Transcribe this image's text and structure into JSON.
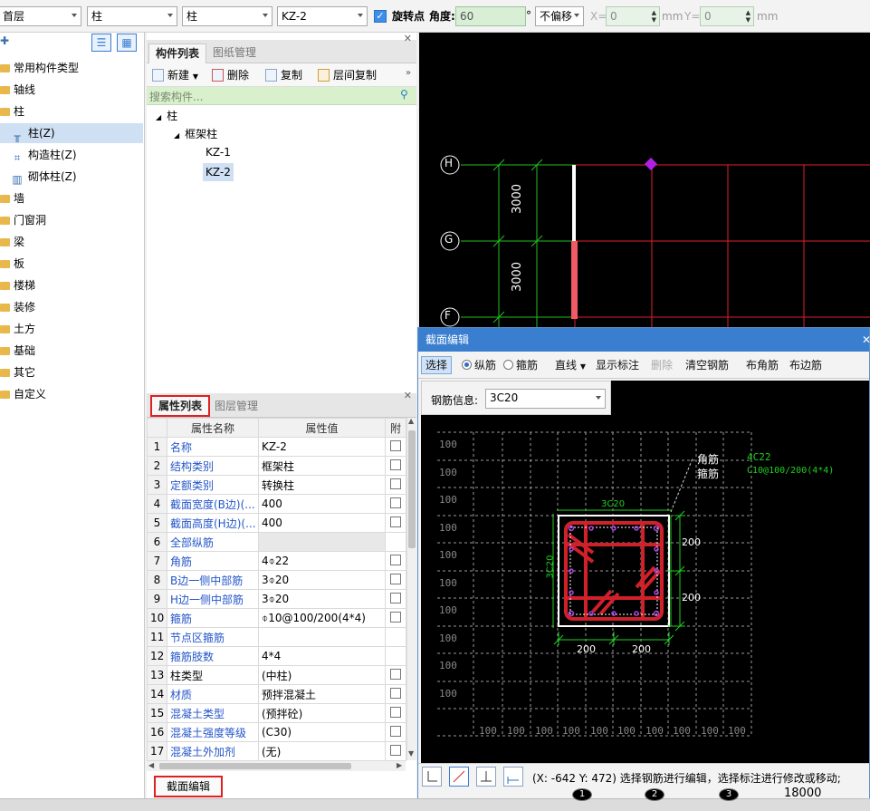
{
  "toolbar": {
    "floor": "首层",
    "category": "柱",
    "subcategory": "柱",
    "component": "KZ-2",
    "rotate_label": "旋转点",
    "angle_label": "角度:",
    "angle_value": "60",
    "degree": "°",
    "offset_mode": "不偏移",
    "x_label": "X=",
    "x_value": "0",
    "mm1": "mm",
    "y_label": "Y=",
    "y_value": "0",
    "mm2": "mm"
  },
  "left_tree": {
    "items": [
      {
        "label": "常用构件类型"
      },
      {
        "label": "轴线"
      },
      {
        "label": "柱"
      },
      {
        "label": "柱(Z)"
      },
      {
        "label": "构造柱(Z)"
      },
      {
        "label": "砌体柱(Z)"
      },
      {
        "label": "墙"
      },
      {
        "label": "门窗洞"
      },
      {
        "label": "梁"
      },
      {
        "label": "板"
      },
      {
        "label": "楼梯"
      },
      {
        "label": "装修"
      },
      {
        "label": "土方"
      },
      {
        "label": "基础"
      },
      {
        "label": "其它"
      },
      {
        "label": "自定义"
      }
    ]
  },
  "component_list": {
    "tab_active": "构件列表",
    "tab_other": "图纸管理",
    "new_btn": "新建",
    "delete_btn": "删除",
    "copy_btn": "复制",
    "floor_copy_btn": "层间复制",
    "search_placeholder": "搜索构件...",
    "tree": {
      "root": "柱",
      "group": "框架柱",
      "items": [
        "KZ-1",
        "KZ-2"
      ]
    }
  },
  "properties": {
    "tab_active": "属性列表",
    "tab_other": "图层管理",
    "col_name": "属性名称",
    "col_value": "属性值",
    "col_extra": "附",
    "rows": [
      {
        "n": "1",
        "name": "名称",
        "value": "KZ-2"
      },
      {
        "n": "2",
        "name": "结构类别",
        "value": "框架柱"
      },
      {
        "n": "3",
        "name": "定额类别",
        "value": "转换柱"
      },
      {
        "n": "4",
        "name": "截面宽度(B边)(...",
        "value": "400"
      },
      {
        "n": "5",
        "name": "截面高度(H边)(...",
        "value": "400"
      },
      {
        "n": "6",
        "name": "全部纵筋",
        "value": ""
      },
      {
        "n": "7",
        "name": "角筋",
        "value": "4⌽22"
      },
      {
        "n": "8",
        "name": "B边一侧中部筋",
        "value": "3⌽20"
      },
      {
        "n": "9",
        "name": "H边一侧中部筋",
        "value": "3⌽20"
      },
      {
        "n": "10",
        "name": "箍筋",
        "value": "⌽10@100/200(4*4)"
      },
      {
        "n": "11",
        "name": "节点区箍筋",
        "value": ""
      },
      {
        "n": "12",
        "name": "箍筋肢数",
        "value": "4*4"
      },
      {
        "n": "13",
        "name": "柱类型",
        "value": "(中柱)"
      },
      {
        "n": "14",
        "name": "材质",
        "value": "预拌混凝土"
      },
      {
        "n": "15",
        "name": "混凝土类型",
        "value": "(预拌砼)"
      },
      {
        "n": "16",
        "name": "混凝土强度等级",
        "value": "(C30)"
      },
      {
        "n": "17",
        "name": "混凝土外加剂",
        "value": "(无)"
      }
    ],
    "bottom_tab": "截面编辑"
  },
  "canvas": {
    "axes": [
      "H",
      "G",
      "F"
    ],
    "dims": [
      "3000",
      "3000"
    ],
    "bottom_number": "18000",
    "bottom_axes": [
      "1",
      "2",
      "3"
    ]
  },
  "section_editor": {
    "title": "截面编辑",
    "tools": {
      "select": "选择",
      "longitudinal": "纵筋",
      "stirrup": "箍筋",
      "line": "直线",
      "show_dims": "显示标注",
      "delete": "删除",
      "clear": "清空钢筋",
      "corner": "布角筋",
      "edge": "布边筋"
    },
    "rebar_info_label": "钢筋信息:",
    "rebar_info_value": "3C20",
    "legend": {
      "corner_label": "角筋",
      "corner_value": "4C22",
      "stirrup_label": "箍筋",
      "stirrup_value": "C10@100/200(4*4)"
    },
    "top_label": "3C20",
    "side_label": "3C20",
    "dim_200": "200",
    "grid_label": "100",
    "status": "(X: -642 Y: 472) 选择钢筋进行编辑，选择标注进行修改或移动;"
  },
  "colors": {
    "accent": "#3a7ed0",
    "highlight_box": "#e02020",
    "rebar": "#d0202a",
    "dim_green": "#20d020"
  }
}
